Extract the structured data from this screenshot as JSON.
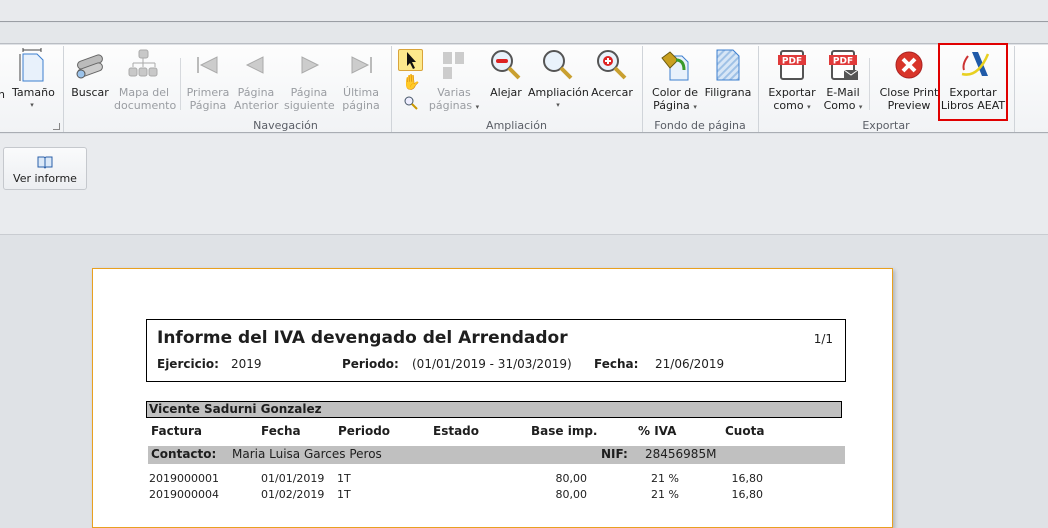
{
  "ribbon": {
    "partial_label": "n",
    "tamano": "Tamaño",
    "buscar": "Buscar",
    "mapa": [
      "Mapa del",
      "documento"
    ],
    "primera": [
      "Primera",
      "Página"
    ],
    "anterior": [
      "Página",
      "Anterior"
    ],
    "siguiente": [
      "Página",
      "siguiente"
    ],
    "ultima": [
      "Última",
      "página"
    ],
    "varias": [
      "Varias",
      "páginas"
    ],
    "alejar": "Alejar",
    "ampliacion": "Ampliación",
    "acercar": "Acercar",
    "color": [
      "Color de",
      "Página"
    ],
    "filigrana": "Filigrana",
    "exportar": [
      "Exportar",
      "como"
    ],
    "email": [
      "E-Mail",
      "Como"
    ],
    "close": [
      "Close Print",
      "Preview"
    ],
    "aeat": [
      "Exportar",
      "Libros AEAT"
    ],
    "groups": {
      "navegacion": "Navegación",
      "ampliacion": "Ampliación",
      "fondo": "Fondo de página",
      "exportar": "Exportar"
    },
    "caret": "▾"
  },
  "ver_informe": "Ver informe",
  "report": {
    "title": "Informe del IVA devengado del Arrendador",
    "page": "1/1",
    "ejercicio_label": "Ejercicio:",
    "ejercicio": "2019",
    "periodo_label": "Periodo:",
    "periodo": "(01/01/2019 - 31/03/2019)",
    "fecha_label": "Fecha:",
    "fecha": "21/06/2019",
    "owner": "Vicente Sadurni Gonzalez",
    "columns": [
      "Factura",
      "Fecha",
      "Periodo",
      "Estado",
      "Base imp.",
      "% IVA",
      "Cuota"
    ],
    "contacto_label": "Contacto:",
    "contacto": "Maria Luisa Garces Peros",
    "nif_label": "NIF:",
    "nif": "28456985M",
    "rows": [
      [
        "2019000001",
        "01/01/2019",
        "1T",
        "",
        "80,00",
        "21 %",
        "16,80"
      ],
      [
        "2019000004",
        "01/02/2019",
        "1T",
        "",
        "80,00",
        "21 %",
        "16,80"
      ]
    ]
  },
  "colors": {
    "highlight": "#e00000",
    "page_border": "#e8a020"
  }
}
